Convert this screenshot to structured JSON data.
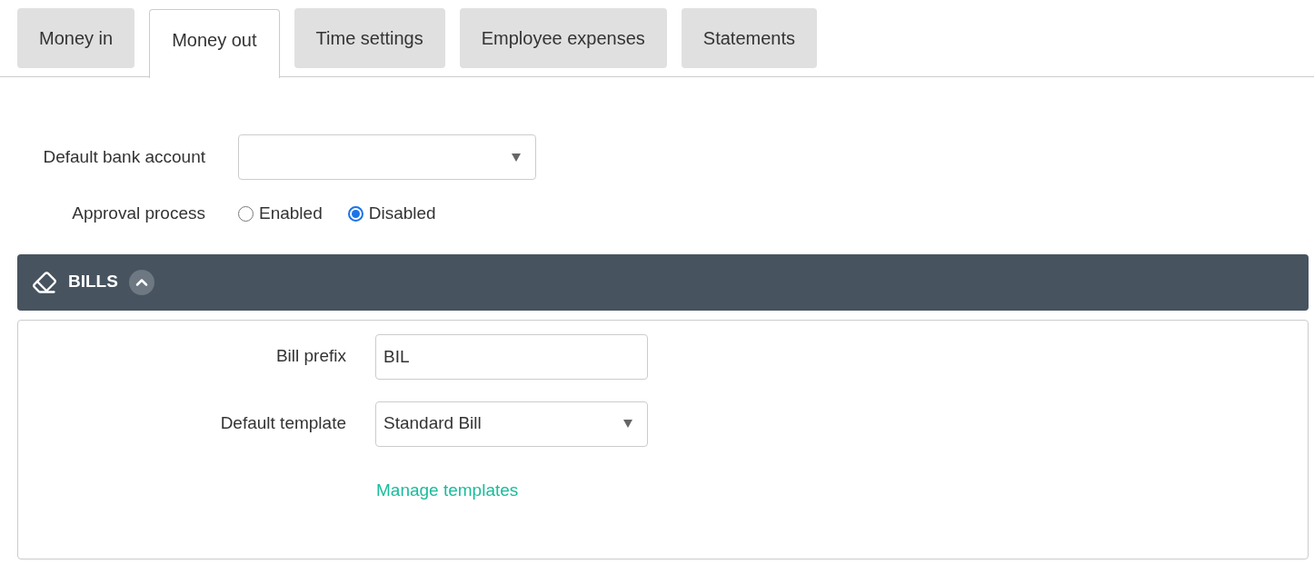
{
  "tabs": [
    {
      "label": "Money in",
      "selected": false
    },
    {
      "label": "Money out",
      "selected": true
    },
    {
      "label": "Time settings",
      "selected": false
    },
    {
      "label": "Employee expenses",
      "selected": false
    },
    {
      "label": "Statements",
      "selected": false
    }
  ],
  "default_bank_account": {
    "label": "Default bank account"
  },
  "approval_process": {
    "label": "Approval process",
    "options": [
      {
        "label": "Enabled",
        "selected": false
      },
      {
        "label": "Disabled",
        "selected": true
      }
    ]
  },
  "bills": {
    "title": "BILLS",
    "expanded": true,
    "bill_prefix": {
      "label": "Bill prefix",
      "value": "BIL"
    },
    "default_template": {
      "label": "Default template",
      "value": "Standard Bill"
    },
    "manage_templates_link": "Manage templates"
  }
}
